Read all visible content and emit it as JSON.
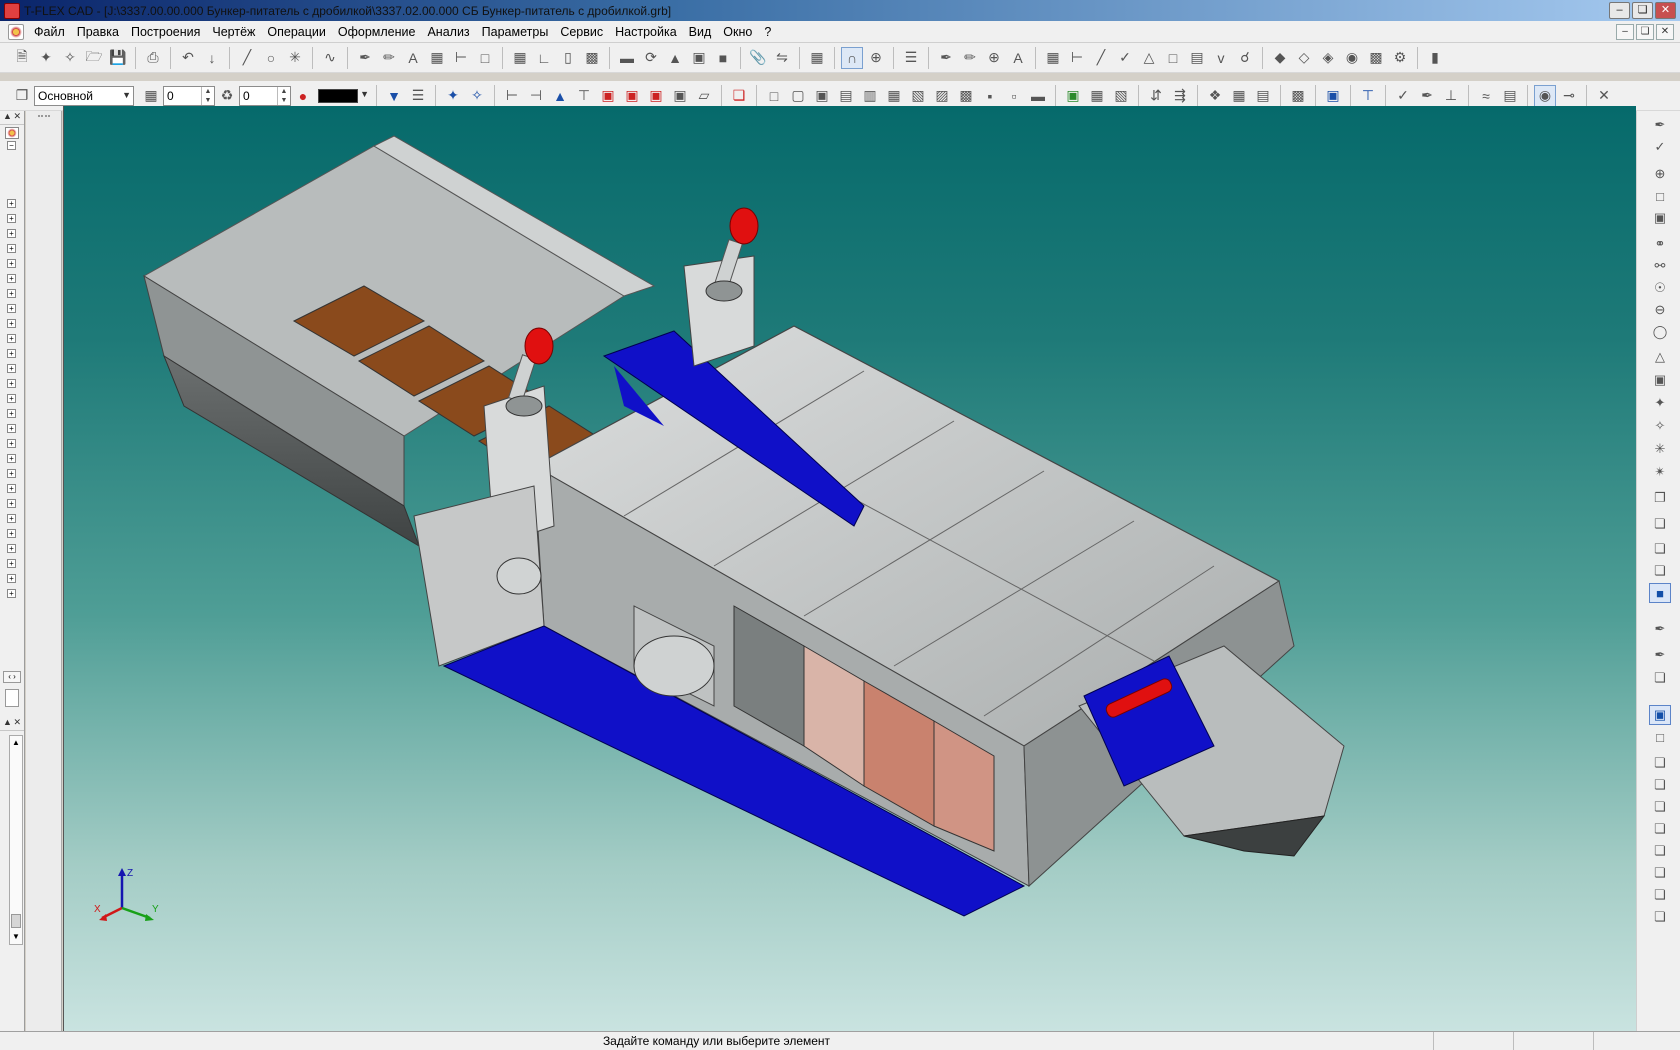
{
  "window": {
    "title": "T-FLEX CAD - [J:\\3337.00.00.000 Бункер-питатель с дробилкой\\3337.02.00.000 СБ Бункер-питатель с дробилкой.grb]"
  },
  "menu": {
    "items": [
      "Файл",
      "Правка",
      "Построения",
      "Чертёж",
      "Операции",
      "Оформление",
      "Анализ",
      "Параметры",
      "Сервис",
      "Настройка",
      "Вид",
      "Окно",
      "?"
    ]
  },
  "toolbar2": {
    "layer": "Основной",
    "level_value": "0",
    "priority_value": "0",
    "line_color": "#000000"
  },
  "viewport": {
    "axis_labels": {
      "x": "X",
      "y": "Y",
      "z": "Z"
    },
    "model": {
      "body_color": "#c6c8c8",
      "accent_blue": "#1010c8",
      "floor_brown": "#8a4a1c",
      "cylinder_red": "#e01010"
    }
  },
  "status": {
    "message": "Задайте команду или выберите элемент"
  },
  "colors": {
    "viewport_top": "#066a6b",
    "viewport_bottom": "#c9e3e0"
  }
}
